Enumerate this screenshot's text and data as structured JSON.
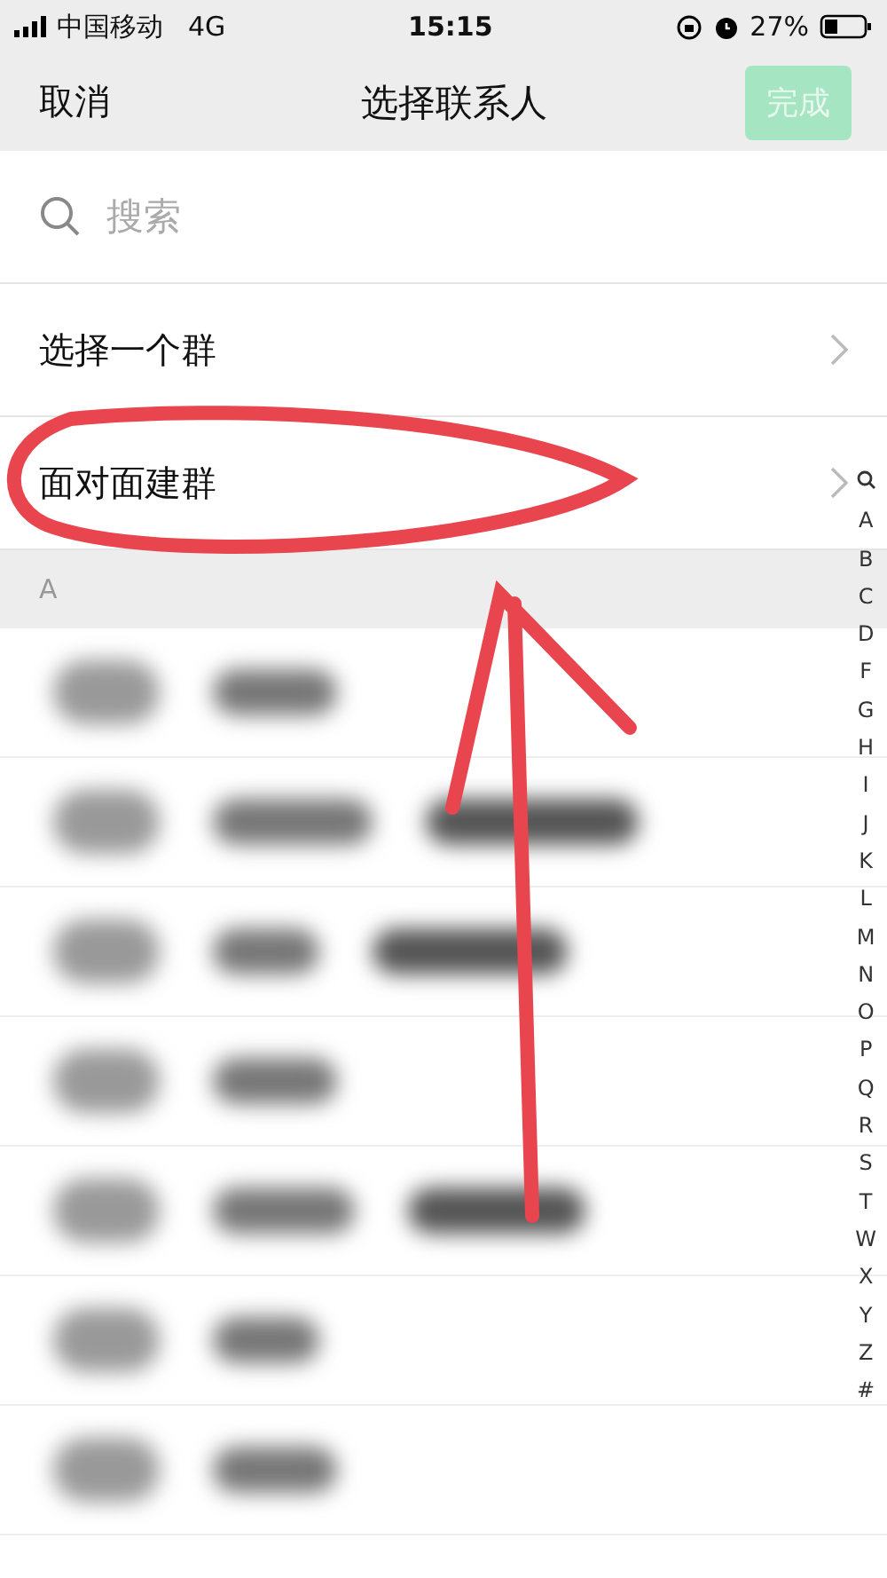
{
  "status_bar": {
    "carrier": "中国移动",
    "network": "4G",
    "time": "15:15",
    "battery": "27%"
  },
  "nav": {
    "cancel": "取消",
    "title": "选择联系人",
    "done": {
      "label": "完成",
      "disabled": true
    }
  },
  "search": {
    "placeholder": "搜索"
  },
  "menu_items": [
    {
      "label": "选择一个群"
    },
    {
      "label": "面对面建群"
    }
  ],
  "section_header": "A",
  "index_bar": [
    "A",
    "B",
    "C",
    "D",
    "F",
    "G",
    "H",
    "I",
    "J",
    "K",
    "L",
    "M",
    "N",
    "O",
    "P",
    "Q",
    "R",
    "S",
    "T",
    "W",
    "X",
    "Y",
    "Z",
    "#"
  ]
}
